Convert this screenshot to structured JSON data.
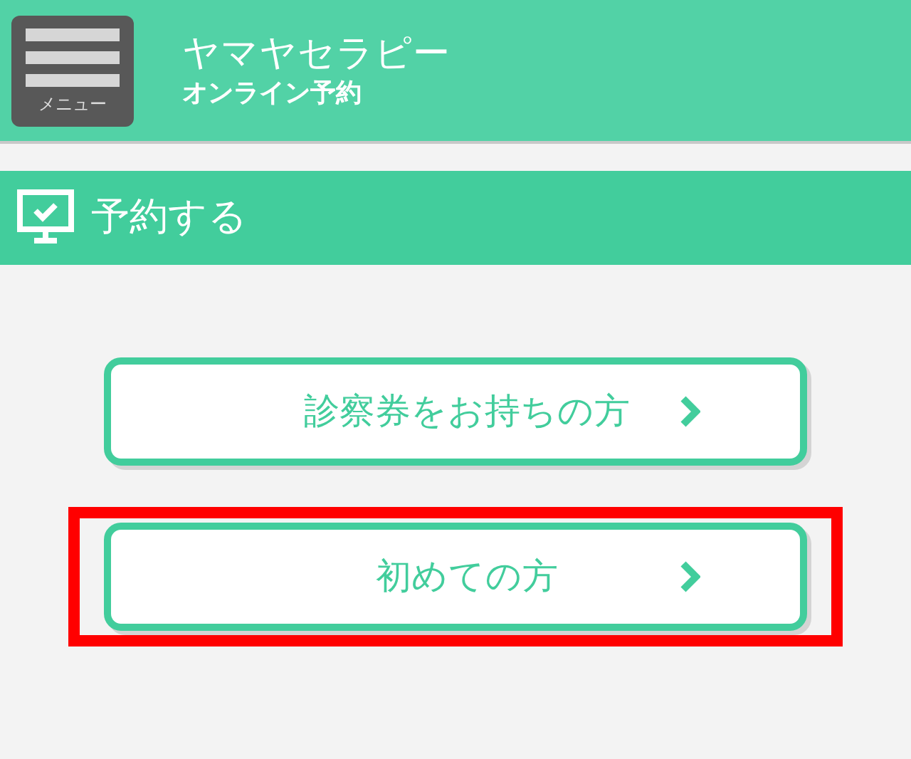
{
  "header": {
    "menu_button": {
      "label": "メニュー"
    },
    "title": "ヤマヤセラピー",
    "subtitle": "オンライン予約"
  },
  "section": {
    "title": "予約する"
  },
  "options": [
    {
      "label": "診察券をお持ちの方",
      "highlighted": false
    },
    {
      "label": "初めての方",
      "highlighted": true
    }
  ]
}
